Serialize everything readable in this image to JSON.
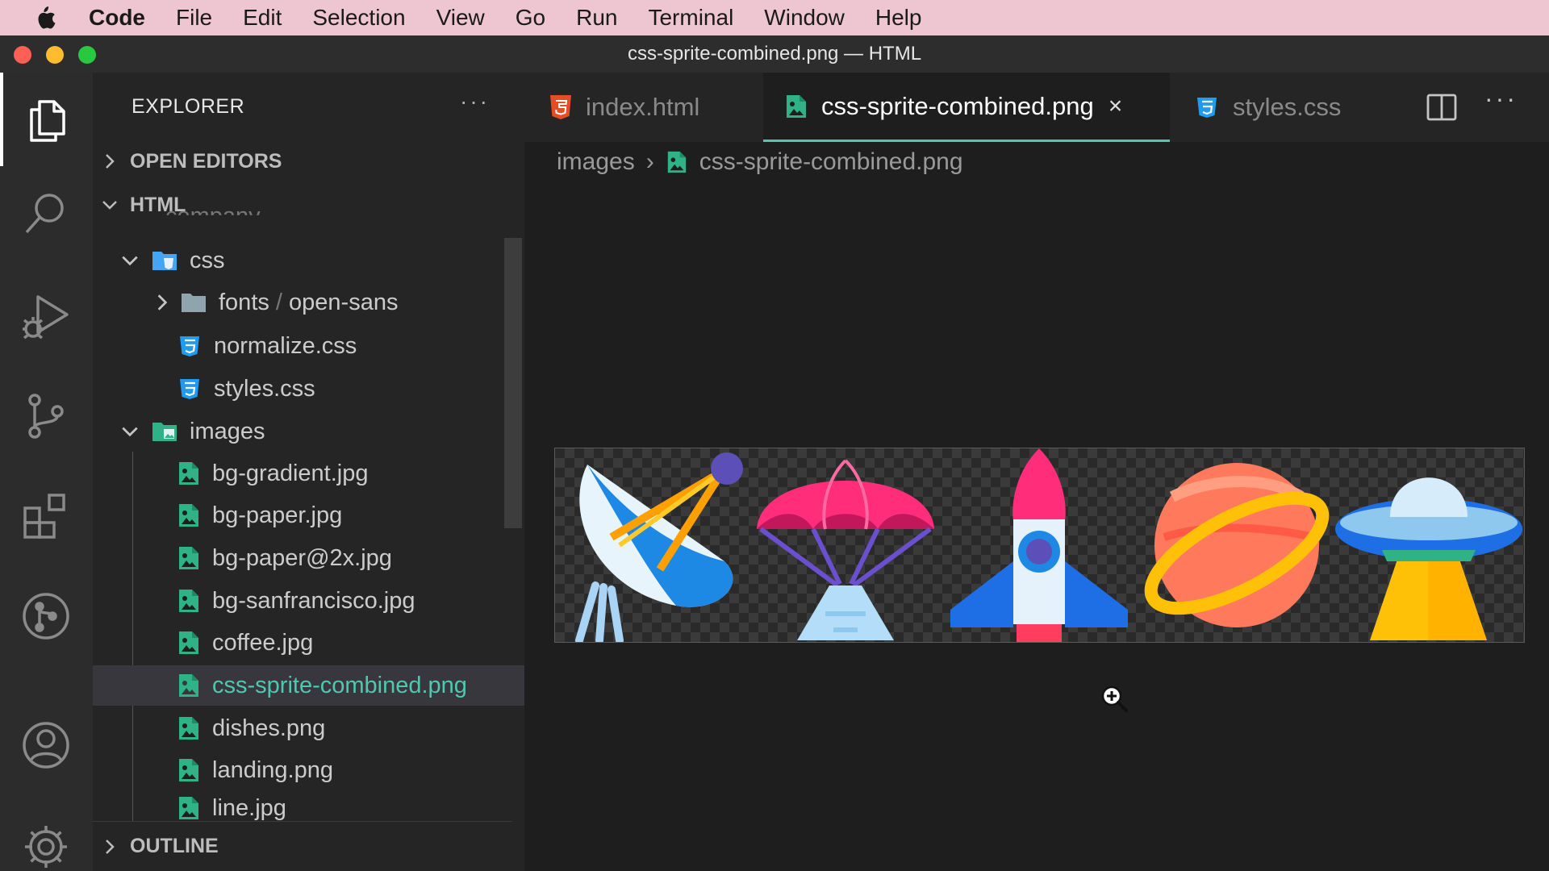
{
  "menubar": {
    "app": "Code",
    "items": [
      "File",
      "Edit",
      "Selection",
      "View",
      "Go",
      "Run",
      "Terminal",
      "Window",
      "Help"
    ]
  },
  "window": {
    "title": "css-sprite-combined.png — HTML"
  },
  "explorer": {
    "header": "EXPLORER",
    "more": "···",
    "sections": {
      "open_editors": "OPEN EDITORS",
      "workspace": "HTML",
      "outline": "OUTLINE"
    },
    "ghost_row": "company",
    "tree": [
      {
        "label": "css",
        "kind": "folder-css",
        "expanded": true
      },
      {
        "label_main": "fonts",
        "label_sep": " / ",
        "label_sub": "open-sans",
        "kind": "folder"
      },
      {
        "label": "normalize.css",
        "kind": "css"
      },
      {
        "label": "styles.css",
        "kind": "css"
      },
      {
        "label": "images",
        "kind": "folder-images",
        "expanded": true
      },
      {
        "label": "bg-gradient.jpg",
        "kind": "image"
      },
      {
        "label": "bg-paper.jpg",
        "kind": "image"
      },
      {
        "label": "bg-paper@2x.jpg",
        "kind": "image"
      },
      {
        "label": "bg-sanfrancisco.jpg",
        "kind": "image"
      },
      {
        "label": "coffee.jpg",
        "kind": "image"
      },
      {
        "label": "css-sprite-combined.png",
        "kind": "image",
        "selected": true
      },
      {
        "label": "dishes.png",
        "kind": "image"
      },
      {
        "label": "landing.png",
        "kind": "image"
      },
      {
        "label": "line.jpg",
        "kind": "image"
      }
    ]
  },
  "tabs": [
    {
      "label": "index.html",
      "icon": "html5-icon",
      "active": false
    },
    {
      "label": "css-sprite-combined.png",
      "icon": "image-file-icon",
      "active": true,
      "close": "×"
    },
    {
      "label": "styles.css",
      "icon": "css3-icon",
      "active": false
    }
  ],
  "tab_actions": {
    "more": "···"
  },
  "breadcrumb": {
    "folder": "images",
    "sep": "›",
    "file": "css-sprite-combined.png"
  },
  "sprite_icons": [
    "satellite-dish-icon",
    "parachute-icon",
    "rocket-icon",
    "planet-icon",
    "ufo-icon"
  ],
  "colors": {
    "accent": "#4ec9b0",
    "html": "#e44d26",
    "css": "#1f9bf0",
    "image": "#2fb386"
  }
}
